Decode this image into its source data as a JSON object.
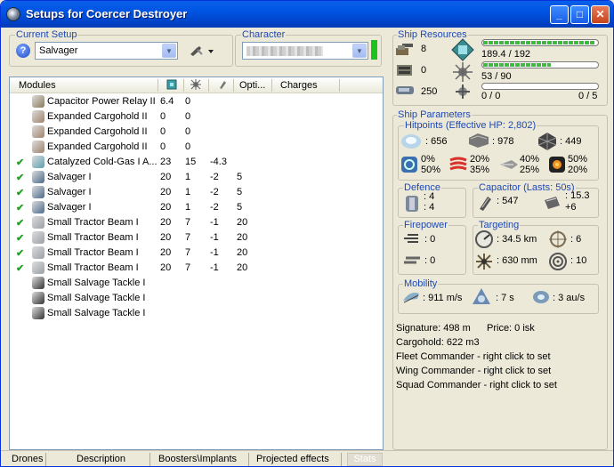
{
  "window": {
    "title": "Setups for Coercer Destroyer"
  },
  "setup": {
    "label": "Current Setup",
    "value": "Salvager",
    "help": "?"
  },
  "character": {
    "label": "Character",
    "value": ""
  },
  "modules": {
    "headers": [
      "Modules",
      "",
      "",
      "",
      "Opti...",
      "Charges"
    ],
    "rows": [
      {
        "checked": false,
        "name": "Capacitor Power Relay II",
        "c1": "6.4",
        "c2": "0",
        "c3": "",
        "c4": "",
        "icon": "capacitor-relay-icon"
      },
      {
        "checked": false,
        "name": "Expanded Cargohold II",
        "c1": "0",
        "c2": "0",
        "c3": "",
        "c4": "",
        "icon": "cargohold-icon"
      },
      {
        "checked": false,
        "name": "Expanded Cargohold II",
        "c1": "0",
        "c2": "0",
        "c3": "",
        "c4": "",
        "icon": "cargohold-icon"
      },
      {
        "checked": false,
        "name": "Expanded Cargohold II",
        "c1": "0",
        "c2": "0",
        "c3": "",
        "c4": "",
        "icon": "cargohold-icon"
      },
      {
        "checked": true,
        "name": "Catalyzed Cold-Gas I A...",
        "c1": "23",
        "c2": "15",
        "c3": "-4.3",
        "c4": "",
        "icon": "afterburner-icon"
      },
      {
        "checked": true,
        "name": "Salvager I",
        "c1": "20",
        "c2": "1",
        "c3": "-2",
        "c4": "5",
        "icon": "salvager-icon"
      },
      {
        "checked": true,
        "name": "Salvager I",
        "c1": "20",
        "c2": "1",
        "c3": "-2",
        "c4": "5",
        "icon": "salvager-icon"
      },
      {
        "checked": true,
        "name": "Salvager I",
        "c1": "20",
        "c2": "1",
        "c3": "-2",
        "c4": "5",
        "icon": "salvager-icon"
      },
      {
        "checked": true,
        "name": "Small Tractor Beam I",
        "c1": "20",
        "c2": "7",
        "c3": "-1",
        "c4": "20",
        "icon": "tractor-beam-icon"
      },
      {
        "checked": true,
        "name": "Small Tractor Beam I",
        "c1": "20",
        "c2": "7",
        "c3": "-1",
        "c4": "20",
        "icon": "tractor-beam-icon"
      },
      {
        "checked": true,
        "name": "Small Tractor Beam I",
        "c1": "20",
        "c2": "7",
        "c3": "-1",
        "c4": "20",
        "icon": "tractor-beam-icon"
      },
      {
        "checked": true,
        "name": "Small Tractor Beam I",
        "c1": "20",
        "c2": "7",
        "c3": "-1",
        "c4": "20",
        "icon": "tractor-beam-icon"
      },
      {
        "checked": false,
        "name": "Small Salvage Tackle I",
        "c1": "",
        "c2": "",
        "c3": "",
        "c4": "",
        "icon": "salvage-tackle-icon"
      },
      {
        "checked": false,
        "name": "Small Salvage Tackle I",
        "c1": "",
        "c2": "",
        "c3": "",
        "c4": "",
        "icon": "salvage-tackle-icon"
      },
      {
        "checked": false,
        "name": "Small Salvage Tackle I",
        "c1": "",
        "c2": "",
        "c3": "",
        "c4": "",
        "icon": "salvage-tackle-icon"
      }
    ]
  },
  "tabs": [
    "Drones",
    "Description",
    "Boosters\\Implants",
    "Projected effects",
    "Stats"
  ],
  "resources": {
    "label": "Ship Resources",
    "high": "8",
    "turret": "0",
    "calib": "250",
    "cpu": "189.4 / 192",
    "cpu_level": 0.986,
    "pg": "53 / 90",
    "pg_level": 0.59,
    "drone": "0 / 0",
    "drone_bw": "0 / 5",
    "drone_level": 0
  },
  "params": {
    "label": "Ship Parameters",
    "hitpoints_label": "Hitpoints (Effective HP: 2,802)",
    "shield": ": 656",
    "armor": ": 978",
    "hull": ": 449",
    "resists": [
      [
        "0%",
        "50%"
      ],
      [
        "20%",
        "35%"
      ],
      [
        "40%",
        "25%"
      ],
      [
        "50%",
        "20%"
      ]
    ],
    "defence_label": "Defence",
    "def1": ": 4",
    "def2": ": 4",
    "cap_label": "Capacitor (Lasts: 50s)",
    "cap_amount": ": 547",
    "cap_rate": ": 15.3",
    "cap_rate2": "+6",
    "firepower_label": "Firepower",
    "fp1": ": 0",
    "fp2": ": 0",
    "targeting_label": "Targeting",
    "range": ": 34.5 km",
    "max_targets": ": 6",
    "scan_res": ": 630 mm",
    "sensor": ": 10",
    "mobility_label": "Mobility",
    "velocity": ": 911 m/s",
    "align": ": 7 s",
    "warp": ": 3 au/s",
    "signature": "Signature: 498 m",
    "price": "Price: 0 isk",
    "cargohold": "Cargohold: 622 m3",
    "fleet": "Fleet Commander - right click to set",
    "wing": "Wing Commander - right click to set",
    "squad": "Squad Commander - right click to set"
  }
}
